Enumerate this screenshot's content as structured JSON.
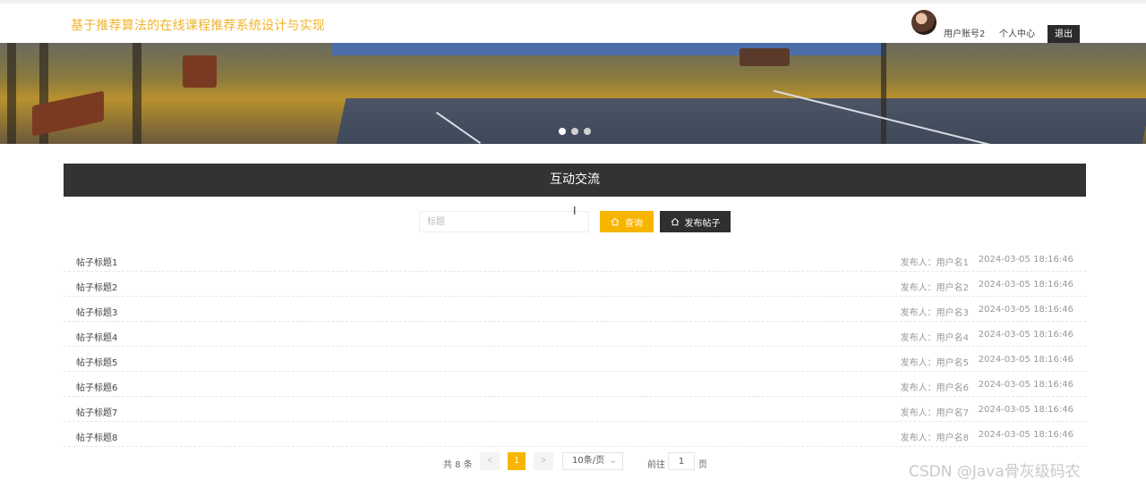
{
  "header": {
    "site_title": "基于推荐算法的在线课程推荐系统设计与实现",
    "user_name": "用户账号2",
    "user_center": "个人中心",
    "logout": "退出"
  },
  "banner": {
    "slide_count": 3,
    "active_slide": 1
  },
  "section": {
    "title": "互动交流"
  },
  "search": {
    "placeholder": "标题",
    "search_label": "查询",
    "post_label": "发布帖子"
  },
  "posts": [
    {
      "title": "帖子标题1",
      "author": "发布人：用户名1",
      "time": "2024-03-05 18:16:46"
    },
    {
      "title": "帖子标题2",
      "author": "发布人：用户名2",
      "time": "2024-03-05 18:16:46"
    },
    {
      "title": "帖子标题3",
      "author": "发布人：用户名3",
      "time": "2024-03-05 18:16:46"
    },
    {
      "title": "帖子标题4",
      "author": "发布人：用户名4",
      "time": "2024-03-05 18:16:46"
    },
    {
      "title": "帖子标题5",
      "author": "发布人：用户名5",
      "time": "2024-03-05 18:16:46"
    },
    {
      "title": "帖子标题6",
      "author": "发布人：用户名6",
      "time": "2024-03-05 18:16:46"
    },
    {
      "title": "帖子标题7",
      "author": "发布人：用户名7",
      "time": "2024-03-05 18:16:46"
    },
    {
      "title": "帖子标题8",
      "author": "发布人：用户名8",
      "time": "2024-03-05 18:16:46"
    }
  ],
  "pagination": {
    "total": "共 8 条",
    "prev": "<",
    "current": "1",
    "next": ">",
    "page_size": "10条/页",
    "goto_label": "前往",
    "goto_value": "1",
    "goto_unit": "页"
  },
  "watermark": "CSDN @Java骨灰级码农",
  "colors": {
    "accent": "#f7b500",
    "title": "#f0b429",
    "dark": "#333333"
  }
}
